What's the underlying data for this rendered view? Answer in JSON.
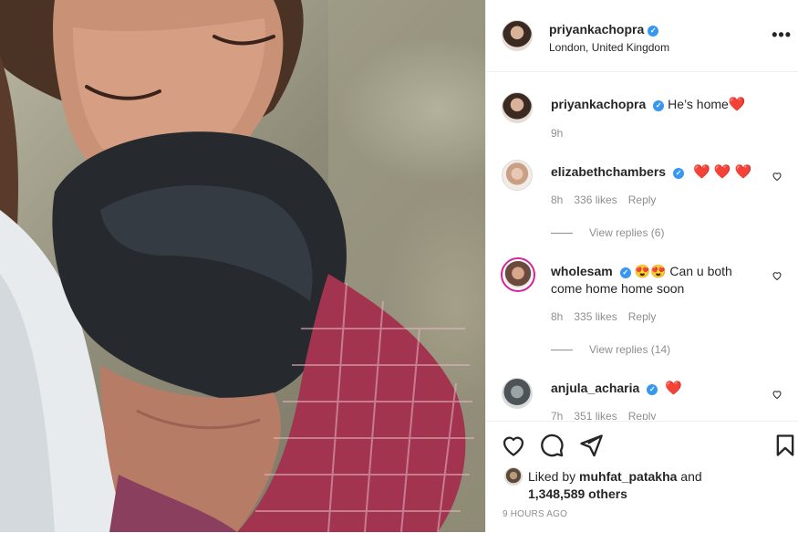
{
  "post": {
    "username": "priyankachopra",
    "location": "London, United Kingdom",
    "more_icon": "more-horizontal-icon",
    "caption": {
      "username": "priyankachopra",
      "text": "He’s home",
      "emoji": "❤️",
      "time": "9h"
    }
  },
  "comments": [
    {
      "username": "elizabethchambers",
      "text": "❤️ ❤️ ❤️",
      "time": "8h",
      "likes": "336 likes",
      "reply": "Reply",
      "view_replies": "View replies (6)"
    },
    {
      "username": "wholesam",
      "text": "😍😍 Can u both come home home soon",
      "time": "8h",
      "likes": "335 likes",
      "reply": "Reply",
      "view_replies": "View replies (14)"
    },
    {
      "username": "anjula_acharia",
      "text": "❤️",
      "time": "7h",
      "likes": "351 likes",
      "reply": "Reply"
    }
  ],
  "actions": {
    "icons": [
      "heart-icon",
      "comment-icon",
      "share-icon",
      "bookmark-icon"
    ]
  },
  "likes": {
    "prefix": "Liked by",
    "username": "muhfat_patakha",
    "and": "and",
    "count": "1,348,589 others"
  },
  "time_ago": "9 HOURS AGO",
  "colors": {
    "verified": "#3897f0",
    "heart": "#e0245e",
    "muted_text": "#8e8e8e",
    "border": "#efefef"
  }
}
